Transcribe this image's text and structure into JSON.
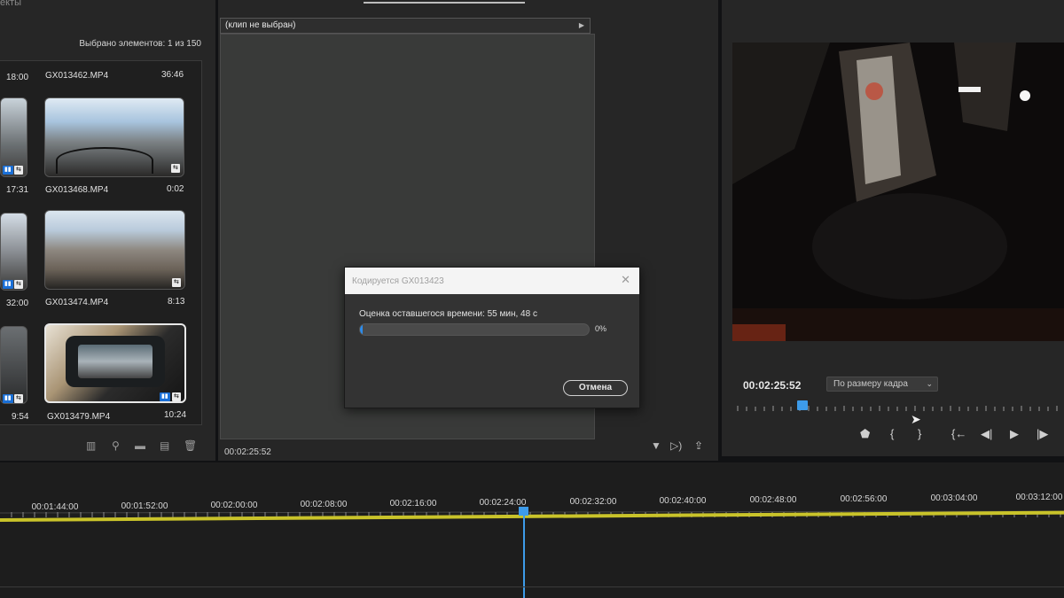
{
  "project_panel": {
    "title": "екты",
    "selection_count": "Выбрано элементов: 1 из 150",
    "clips": [
      {
        "name": "GX013462.MP4",
        "duration": "36:46",
        "left_duration": "18:00"
      },
      {
        "name": "GX013468.MP4",
        "duration": "0:02",
        "left_duration": "17:31"
      },
      {
        "name": "GX013474.MP4",
        "duration": "8:13",
        "left_duration": "32:00"
      },
      {
        "name": "GX013479.MP4",
        "duration": "10:24",
        "left_duration": "9:54"
      }
    ],
    "toolbar_icons": [
      "bin-icon",
      "search-icon",
      "folder-icon",
      "new-item-icon",
      "trash-icon"
    ]
  },
  "source_monitor": {
    "header": "(клип не выбран)",
    "timecode": "00:02:25:52"
  },
  "program_monitor": {
    "timecode": "00:02:25:52",
    "fit_option": "По размеру кадра"
  },
  "timeline": {
    "tick_labels": [
      "00:01:44:00",
      "00:01:52:00",
      "00:02:00:00",
      "00:02:08:00",
      "00:02:16:00",
      "00:02:24:00",
      "00:02:32:00",
      "00:02:40:00",
      "00:02:48:00",
      "00:02:56:00",
      "00:03:04:00",
      "00:03:12:00"
    ]
  },
  "dialog": {
    "title": "Кодируется GX013423",
    "estimate": "Оценка оставшегося времени: 55 мин, 48 с",
    "progress_percent": 0,
    "progress_label": "0%",
    "cancel_label": "Отмена"
  },
  "colors": {
    "accent_blue": "#2d8ceb",
    "work_area_yellow": "#c9c32a",
    "panel_bg": "#262626"
  }
}
